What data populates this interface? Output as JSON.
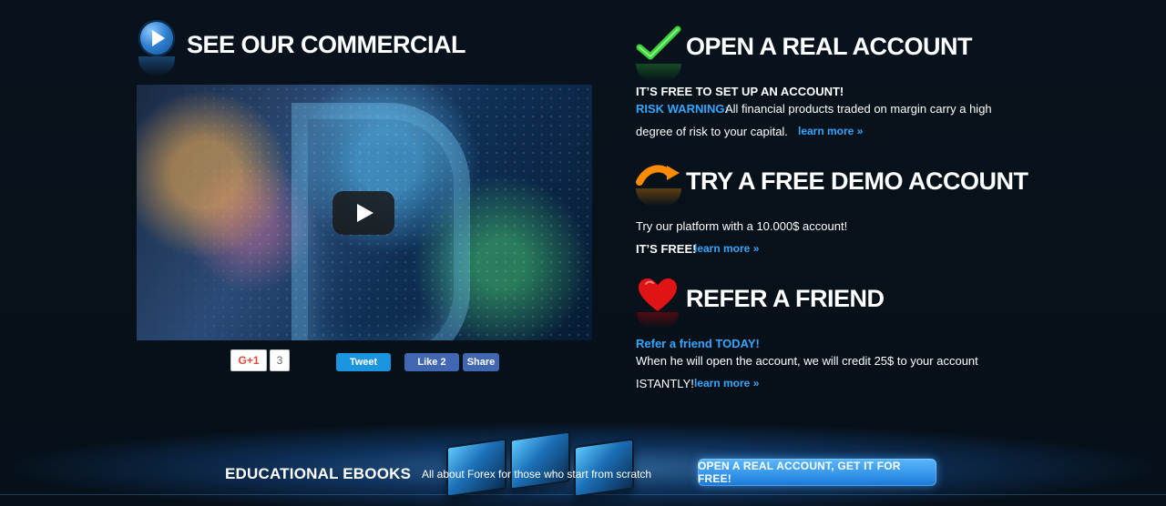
{
  "sections": {
    "commercial": {
      "title": "SEE OUR COMMERCIAL",
      "social": {
        "gplus_label": "G+1",
        "gplus_count": "3",
        "tweet_label": "Tweet",
        "fb_like_label": "Like 2",
        "fb_share_label": "Share"
      }
    },
    "real_account": {
      "title": "OPEN A REAL ACCOUNT",
      "line1": "IT’S FREE TO SET UP AN ACCOUNT!",
      "risk_label": "RISK WARNING:",
      "risk_text": "All financial products traded on margin carry a high",
      "risk_text_2": "degree of risk to your capital.",
      "learn_more": "learn more »"
    },
    "demo_account": {
      "title": "TRY A FREE DEMO ACCOUNT",
      "line1": "Try our platform with a 10.000$ account!",
      "line2": "IT’S FREE!",
      "learn_more": "learn more »"
    },
    "refer_friend": {
      "title": "REFER A FRIEND",
      "line1": "Refer a friend TODAY!",
      "line2": "When he will open the account, we will credit 25$ to your account",
      "line3": "ISTANTLY!",
      "learn_more": "learn more »"
    }
  },
  "bottom": {
    "ebooks_title": "EDUCATIONAL EBOOKS",
    "ebooks_subtitle": "All about Forex for those who start from scratch",
    "cta_label": "OPEN A REAL ACCOUNT, GET IT FOR FREE!"
  },
  "colors": {
    "background": "#06101a",
    "accent_blue": "#35a6ff",
    "cta_blue": "#1b79d8"
  },
  "icons": {
    "commercial": "play-circle-icon",
    "real_account": "checkmark-icon",
    "demo_account": "arrow-icon",
    "refer_friend": "heart-icon"
  }
}
